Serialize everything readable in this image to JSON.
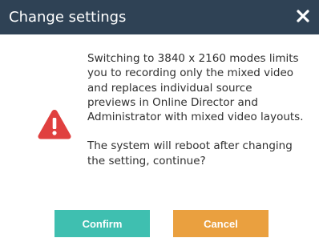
{
  "dialog": {
    "title": "Change settings",
    "close_icon": "close-icon",
    "warning_icon": "warning-triangle-icon",
    "message_paragraph_1": "Switching to 3840 x 2160 modes limits you to recording only the mixed video and replaces individual source previews in Online Director and Administrator with mixed video layouts.",
    "message_paragraph_2": "The system will reboot after changing the setting, continue?",
    "confirm_label": "Confirm",
    "cancel_label": "Cancel"
  },
  "colors": {
    "titlebar": "#2f4255",
    "warning": "#e0403f",
    "confirm": "#3fbfb0",
    "cancel": "#eaa03f"
  }
}
